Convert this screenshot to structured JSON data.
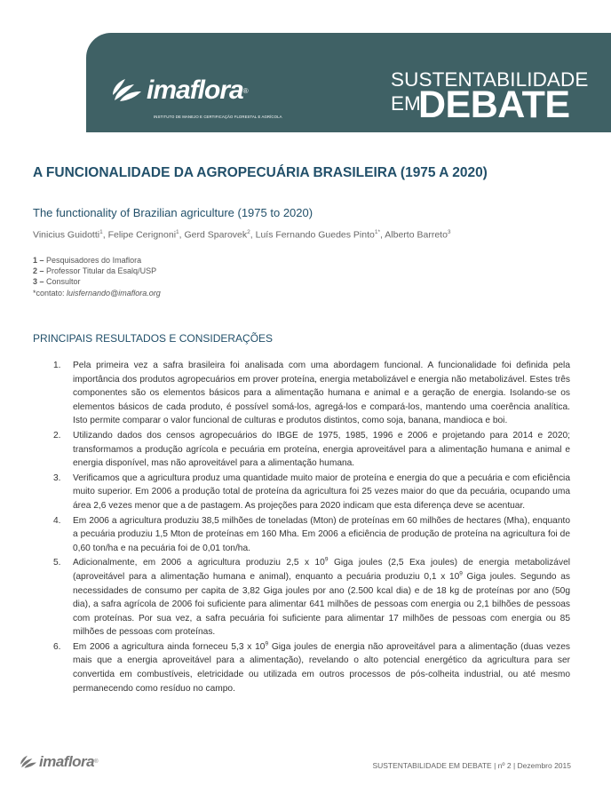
{
  "header": {
    "logo_text": "imaflora",
    "logo_reg": "®",
    "logo_tagline": "INSTITUTO DE MANEJO E CERTIFICAÇÃO FLORESTAL E AGRÍCOLA",
    "series_line1": "SUSTENTABILIDADE",
    "series_em": "EM",
    "series_debate": "DEBATE",
    "banner_color": "#3f6165"
  },
  "article": {
    "title": "A FUNCIONALIDADE DA AGROPECUÁRIA BRASILEIRA (1975 A 2020)",
    "subtitle": "The functionality of Brazilian agriculture (1975 to 2020)",
    "authors": [
      {
        "name": "Vinicius Guidotti",
        "sup": "1",
        "sep": ", "
      },
      {
        "name": "Felipe Cerignoni",
        "sup": "1",
        "sep": ", "
      },
      {
        "name": "Gerd Sparovek",
        "sup": "2",
        "sep": ", "
      },
      {
        "name": "Luís Fernando Guedes Pinto",
        "sup": "1*",
        "sep": ", "
      },
      {
        "name": "Alberto Barreto",
        "sup": "3",
        "sep": ""
      }
    ],
    "affiliations": [
      {
        "num": "1 –",
        "text": " Pesquisadores do Imaflora"
      },
      {
        "num": "2 –",
        "text": " Professor Titular da Esalq/USP"
      },
      {
        "num": "3 –",
        "text": " Consultor"
      }
    ],
    "contact_label": "*contato: ",
    "contact_email": "luisfernando@imaflora.org",
    "section_heading": "PRINCIPAIS RESULTADOS E CONSIDERAÇÕES",
    "items": [
      {
        "num": "1.",
        "text": "Pela primeira vez a safra brasileira foi analisada com uma abordagem funcional. A funcionalidade foi definida pela importância dos produtos agropecuários em prover proteína, energia metabolizável e energia não metabolizável. Estes três componentes são os elementos básicos para a alimentação humana e animal e a geração de energia. Isolando-se os elementos básicos de cada produto, é possível somá-los, agregá-los e compará-los, mantendo uma coerência analítica. Isto permite comparar o valor funcional de culturas e produtos distintos, como soja, banana, mandioca e boi."
      },
      {
        "num": "2.",
        "text": "Utilizando dados dos censos agropecuários do IBGE de 1975, 1985, 1996 e 2006 e projetando para 2014 e 2020; transformamos a produção agrícola e pecuária em proteína, energia aproveitável para a alimentação humana e animal e energia disponível, mas não aproveitável para a alimentação humana."
      },
      {
        "num": "3.",
        "text": "Verificamos que a agricultura produz uma quantidade muito maior de proteína e energia do que a pecuária e com eficiência muito superior. Em 2006 a produção total de proteína da agricultura foi 25 vezes maior do que da pecuária, ocupando uma área 2,6 vezes menor que a de pastagem. As projeções para 2020 indicam que esta diferença deve se acentuar."
      },
      {
        "num": "4.",
        "text": "Em 2006 a agricultura produziu 38,5 milhões de toneladas (Mton) de proteínas em 60 milhões de hectares (Mha), enquanto a pecuária produziu 1,5 Mton de proteínas em 160 Mha. Em 2006 a eficiência de produção de proteína na agricultura foi de 0,60 ton/ha e na pecuária foi de 0,01 ton/ha."
      },
      {
        "num": "5.",
        "text_parts": [
          "Adicionalmente, em 2006 a agricultura produziu 2,5 x 10",
          "9",
          " Giga joules (2,5 Exa joules) de energia metabolizável (aproveitável para a alimentação humana e animal), enquanto a pecuária produziu 0,1 x 10",
          "9",
          " Giga joules. Segundo as necessidades de consumo per capita de 3,82 Giga joules por ano (2.500 kcal dia) e de 18 kg de proteínas por ano (50g dia), a safra agrícola de 2006 foi suficiente para alimentar 641 milhões de pessoas com energia ou 2,1 bilhões de pessoas com proteínas. Por sua vez, a safra pecuária foi suficiente para alimentar 17 milhões de pessoas com energia ou 85 milhões de pessoas com proteínas."
        ]
      },
      {
        "num": "6.",
        "text_parts": [
          "Em 2006 a agricultura ainda forneceu 5,3 x 10",
          "9",
          " Giga joules de energia não aproveitável para a alimentação (duas vezes mais que a energia aproveitável para a alimentação), revelando o alto potencial energético da agricultura para ser convertida em combustíveis, eletricidade ou utilizada em outros processos de pós-colheita industrial, ou até mesmo permanecendo como resíduo no campo."
        ]
      }
    ]
  },
  "footer": {
    "logo_text": "imaflora",
    "logo_reg": "®",
    "right_text": "SUSTENTABILIDADE EM DEBATE | nº 2 | Dezembro 2015"
  }
}
